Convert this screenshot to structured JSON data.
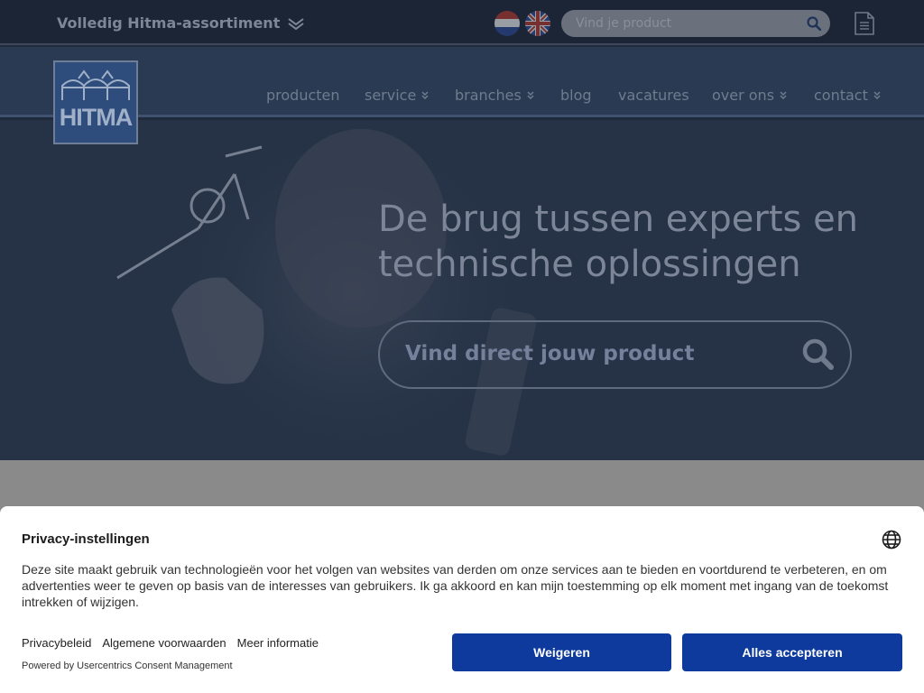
{
  "topbar": {
    "assortment_label": "Volledig Hitma-assortiment",
    "search_placeholder": "Vind je product"
  },
  "logo": {
    "text": "HITMA"
  },
  "nav": {
    "items": [
      {
        "label": "producten",
        "dropdown": false
      },
      {
        "label": "service",
        "dropdown": true
      },
      {
        "label": "branches",
        "dropdown": true
      },
      {
        "label": "blog",
        "dropdown": false
      },
      {
        "label": "vacatures",
        "dropdown": false
      },
      {
        "label": "over ons",
        "dropdown": true
      },
      {
        "label": "contact",
        "dropdown": true
      }
    ]
  },
  "hero": {
    "title_line1": "De brug tussen experts en",
    "title_line2": "technische oplossingen",
    "search_placeholder": "Vind direct jouw product"
  },
  "consent": {
    "title": "Privacy-instellingen",
    "text": "Deze site maakt gebruik van technologieën voor het volgen van websites van derden om onze services aan te bieden en voortdurend te verbeteren, en om advertenties weer te geven op basis van de interesses van gebruikers. Ik ga akkoord en kan mijn toestemming op elk moment met ingang van de toekomst intrekken of wijzigen.",
    "links": [
      "Privacybeleid",
      "Algemene voorwaarden",
      "Meer informatie"
    ],
    "powered_by": "Powered by Usercentrics Consent Management",
    "deny_label": "Weigeren",
    "accept_label": "Alles accepteren"
  },
  "colors": {
    "button_blue": "#0d3a9c",
    "logo_blue": "#2f4d7c"
  }
}
